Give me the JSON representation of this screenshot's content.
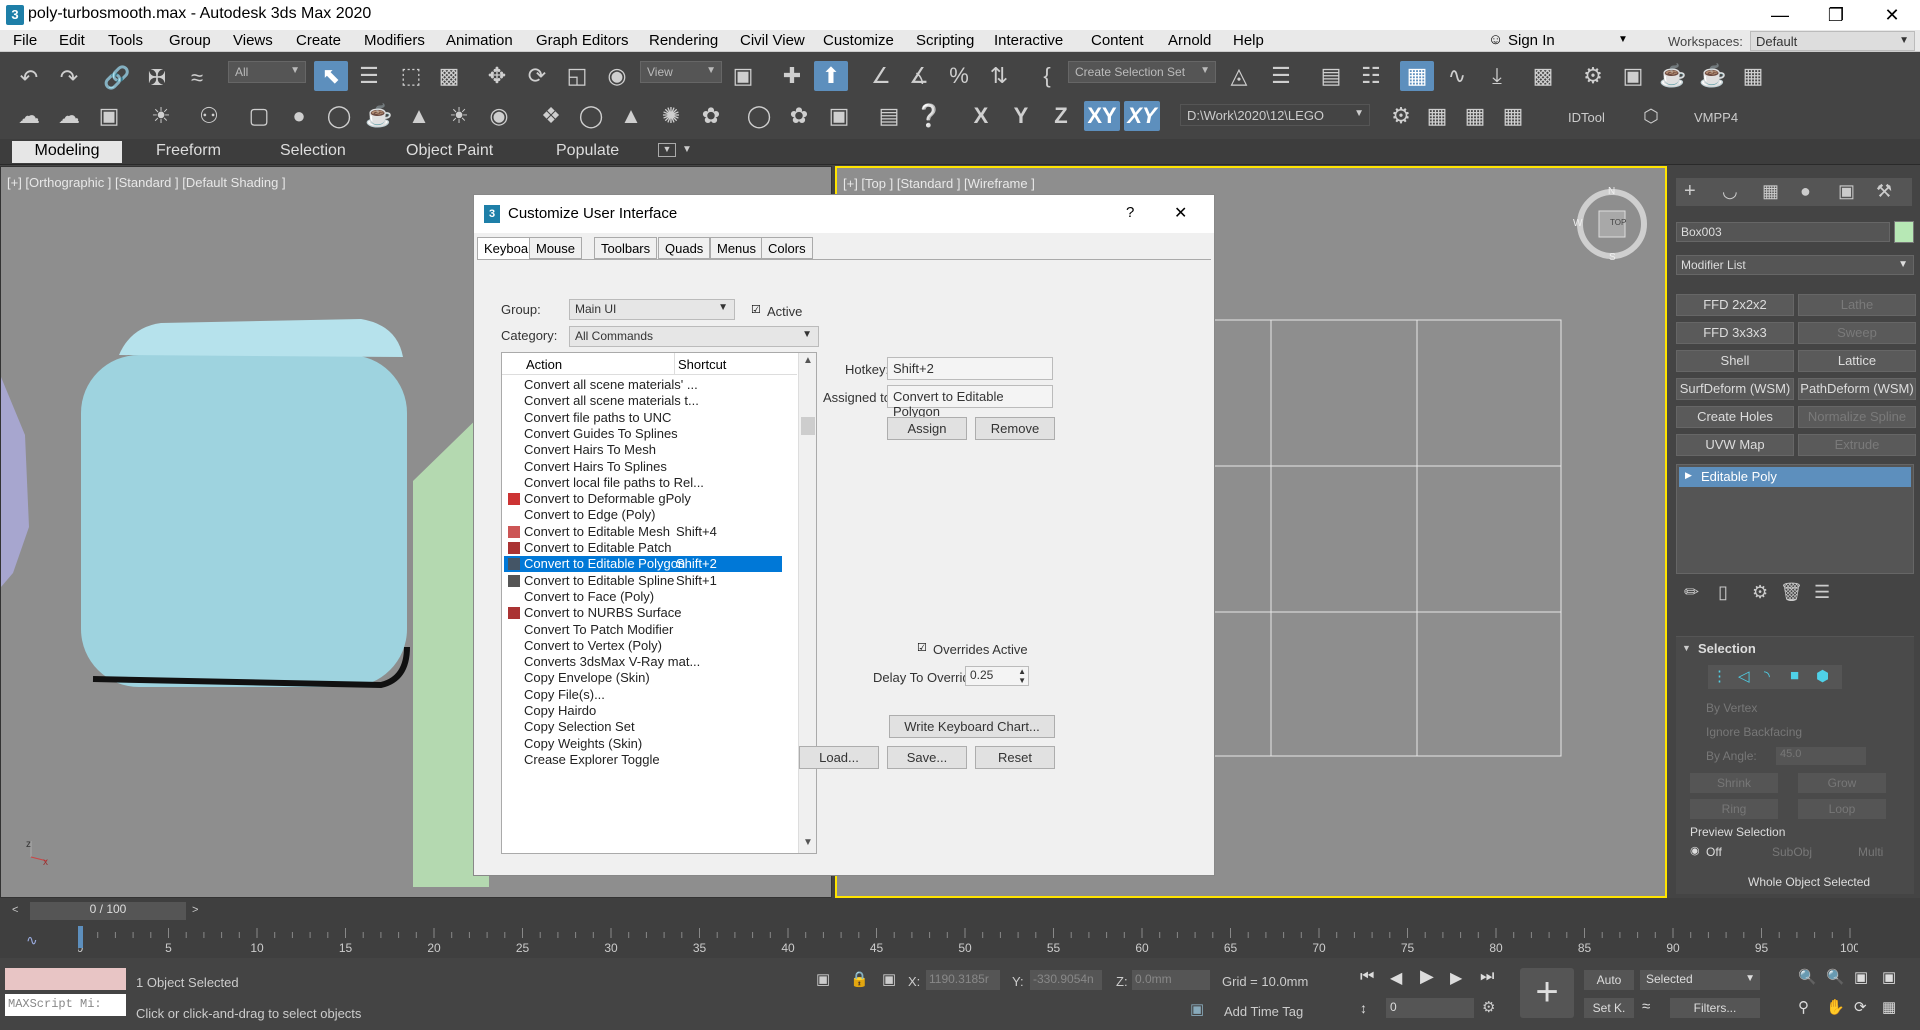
{
  "window": {
    "title": "poly-turbosmooth.max - Autodesk 3ds Max 2020",
    "app_icon": "3"
  },
  "menu": [
    "File",
    "Edit",
    "Tools",
    "Group",
    "Views",
    "Create",
    "Modifiers",
    "Animation",
    "Graph Editors",
    "Rendering",
    "Civil View",
    "Customize",
    "Scripting",
    "Interactive",
    "Content",
    "Arnold",
    "Help"
  ],
  "sign_in": "Sign In",
  "workspaces": {
    "label": "Workspaces:",
    "value": "Default"
  },
  "toolbar1": {
    "filter": "All",
    "view": "View",
    "selection_set": "Create Selection Set"
  },
  "toolbar2": {
    "path": "D:\\Work\\2020\\12\\LEGO",
    "axes": [
      "X",
      "Y",
      "Z",
      "XY",
      "XY"
    ],
    "idtool": "IDTool",
    "vmpp": "VMPP4"
  },
  "ribbon": {
    "tabs": [
      "Modeling",
      "Freeform",
      "Selection",
      "Object Paint",
      "Populate"
    ],
    "active": 0
  },
  "viewports": {
    "left_label": "[+] [Orthographic ] [Standard ] [Default Shading ]",
    "right_label": "[+] [Top ] [Standard ] [Wireframe ]",
    "viewcube": "TOP",
    "compass": [
      "N",
      "S",
      "W"
    ]
  },
  "dialog": {
    "title": "Customize User Interface",
    "help": "?",
    "close": "✕",
    "tabs": [
      "Keyboard",
      "Mouse",
      "Toolbars",
      "Quads",
      "Menus",
      "Colors"
    ],
    "group_label": "Group:",
    "group_value": "Main UI",
    "active_label": "Active",
    "category_label": "Category:",
    "category_value": "All Commands",
    "col_action": "Action",
    "col_shortcut": "Shortcut",
    "rows": [
      {
        "action": "Convert all scene materials' ...",
        "shortcut": ""
      },
      {
        "action": "Convert all scene materials t...",
        "shortcut": ""
      },
      {
        "action": "Convert file paths to UNC",
        "shortcut": ""
      },
      {
        "action": "Convert Guides To Splines",
        "shortcut": ""
      },
      {
        "action": "Convert Hairs To Mesh",
        "shortcut": ""
      },
      {
        "action": "Convert Hairs To Splines",
        "shortcut": ""
      },
      {
        "action": "Convert local file paths to Rel...",
        "shortcut": ""
      },
      {
        "action": "Convert to Deformable gPoly",
        "shortcut": ""
      },
      {
        "action": "Convert to Edge (Poly)",
        "shortcut": ""
      },
      {
        "action": "Convert to Editable Mesh",
        "shortcut": "Shift+4"
      },
      {
        "action": "Convert to Editable Patch",
        "shortcut": ""
      },
      {
        "action": "Convert to Editable Polygon",
        "shortcut": "Shift+2"
      },
      {
        "action": "Convert to Editable Spline",
        "shortcut": "Shift+1"
      },
      {
        "action": "Convert to Face (Poly)",
        "shortcut": ""
      },
      {
        "action": "Convert to NURBS Surface",
        "shortcut": ""
      },
      {
        "action": "Convert To Patch Modifier",
        "shortcut": ""
      },
      {
        "action": "Convert to Vertex (Poly)",
        "shortcut": ""
      },
      {
        "action": "Converts 3dsMax V-Ray mat...",
        "shortcut": ""
      },
      {
        "action": "Copy Envelope (Skin)",
        "shortcut": ""
      },
      {
        "action": "Copy File(s)...",
        "shortcut": ""
      },
      {
        "action": "Copy Hairdo",
        "shortcut": ""
      },
      {
        "action": "Copy Selection Set",
        "shortcut": ""
      },
      {
        "action": "Copy Weights (Skin)",
        "shortcut": ""
      },
      {
        "action": "Crease Explorer Toggle",
        "shortcut": ""
      }
    ],
    "selected_row": 11,
    "hotkey_label": "Hotkey:",
    "hotkey_value": "Shift+2",
    "assigned_label": "Assigned to:",
    "assigned_value": "Convert to Editable Polygon",
    "assign": "Assign",
    "remove": "Remove",
    "overrides_label": "Overrides Active",
    "delay_label": "Delay To Override:",
    "delay_value": "0.25",
    "write_chart": "Write Keyboard Chart...",
    "load": "Load...",
    "save": "Save...",
    "reset": "Reset"
  },
  "command_panel": {
    "object_name": "Box003",
    "modifier_list": "Modifier List",
    "buttons": [
      {
        "label": "FFD 2x2x2",
        "enabled": true
      },
      {
        "label": "Lathe",
        "enabled": false
      },
      {
        "label": "FFD 3x3x3",
        "enabled": true
      },
      {
        "label": "Sweep",
        "enabled": false
      },
      {
        "label": "Shell",
        "enabled": true
      },
      {
        "label": "Lattice",
        "enabled": true
      },
      {
        "label": "SurfDeform (WSM)",
        "enabled": true
      },
      {
        "label": "PathDeform (WSM)",
        "enabled": true
      },
      {
        "label": "Create Holes",
        "enabled": true
      },
      {
        "label": "Normalize Spline",
        "enabled": false
      },
      {
        "label": "UVW Map",
        "enabled": true
      },
      {
        "label": "Extrude",
        "enabled": false
      }
    ],
    "stack_item": "Editable Poly",
    "selection_title": "Selection",
    "by_vertex": "By Vertex",
    "ignore_backfacing": "Ignore Backfacing",
    "by_angle": "By Angle:",
    "angle_value": "45.0",
    "shrink": "Shrink",
    "grow": "Grow",
    "ring": "Ring",
    "loop": "Loop",
    "preview_selection": "Preview Selection",
    "preview_opts": [
      "Off",
      "SubObj",
      "Multi"
    ],
    "whole_object": "Whole Object Selected"
  },
  "timeline": {
    "frame_display": "0 / 100",
    "ticks": [
      0,
      5,
      10,
      15,
      20,
      25,
      30,
      35,
      40,
      45,
      50,
      55,
      60,
      65,
      70,
      75,
      80,
      85,
      90,
      95,
      100
    ]
  },
  "status": {
    "maxscript": "MAXScript Mi:",
    "objects_selected": "1 Object Selected",
    "prompt": "Click or click-and-drag to select objects",
    "x_label": "X:",
    "x_value": "1190.3185r",
    "y_label": "Y:",
    "y_value": "-330.9054n",
    "z_label": "Z:",
    "z_value": "0.0mm",
    "grid": "Grid = 10.0mm",
    "add_time_tag": "Add Time Tag",
    "auto": "Auto",
    "selected": "Selected",
    "set_key": "Set K.",
    "filters": "Filters...",
    "frame": "0"
  }
}
